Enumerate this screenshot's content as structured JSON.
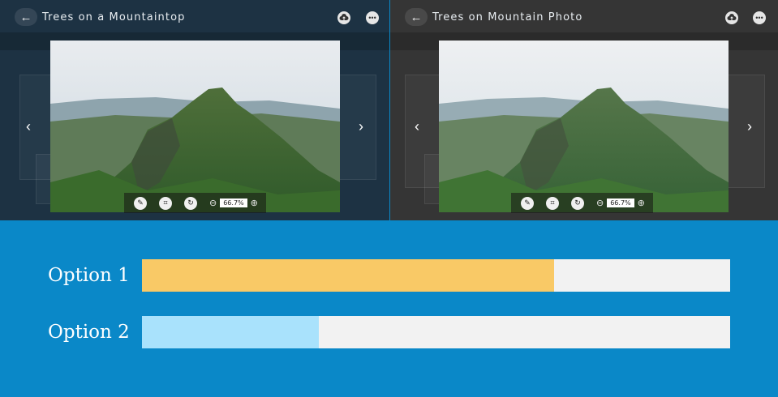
{
  "left_panel": {
    "title": "Trees on a Mountaintop",
    "zoom_value": "66.7%"
  },
  "right_panel": {
    "title": "Trees on Mountain Photo",
    "zoom_value": "66.7%"
  },
  "options": [
    {
      "label": "Option 1",
      "value": 0.7,
      "color": "#f9c966"
    },
    {
      "label": "Option 2",
      "value": 0.3,
      "color": "#a9e2fc"
    }
  ],
  "colors": {
    "background": "#0a88c8",
    "track": "#f2f2f2"
  },
  "icons": {
    "back": "arrow-left-icon",
    "upload": "cloud-upload-icon",
    "more": "more-dots-icon",
    "edit": "pencil-icon",
    "crop": "crop-icon",
    "rotate": "rotate-icon",
    "zoom_out": "zoom-out-icon",
    "zoom_in": "zoom-in-icon",
    "prev": "chevron-left-icon",
    "next": "chevron-right-icon"
  }
}
